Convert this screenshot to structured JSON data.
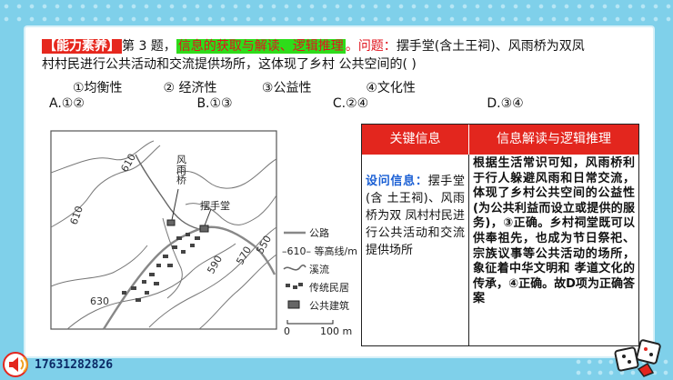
{
  "question": {
    "tag": "【能力素养】",
    "number": "第 3 题，",
    "focus": "信息的获取与解读、逻辑推理",
    "after_focus": "。",
    "ask_label": "问题：",
    "stem_line1_rest": "摆手堂(含土王祠)、风雨桥为双凤",
    "stem_line2": "村村民进行公共活动和交流提供场所，这体现了乡村 公共空间的(     )"
  },
  "statements": [
    "①均衡性",
    "② 经济性",
    "③公益性",
    "④文化性"
  ],
  "options": [
    "A.①②",
    "B.①③",
    "C.②④",
    "D.③④"
  ],
  "map": {
    "labels": {
      "bridge": "风雨桥",
      "hall": "摆手堂",
      "c610a": "610",
      "c610b": "610",
      "c590": "590",
      "c570": "570",
      "c550": "550",
      "c630": "630"
    },
    "legend": [
      {
        "name": "road",
        "text": "公路"
      },
      {
        "name": "contour",
        "text": "–610– 等高线/m"
      },
      {
        "name": "stream",
        "text": "溪流"
      },
      {
        "name": "dwelling",
        "text": "传统民居"
      },
      {
        "name": "public",
        "text": "公共建筑"
      }
    ],
    "scale": {
      "zero": "0",
      "length": "100 m"
    }
  },
  "table": {
    "header_left": "关键信息",
    "header_right": "信息解读与逻辑推理",
    "key_label": "设问信息：",
    "key_text": "摆手堂(含 土王祠)、风雨桥为双 凤村村民进行公共活动和交流提供场所",
    "reasoning": "根据生活常识可知，风雨桥利于行人躲避风雨和日常交流，体现了乡村公共空间的公益性(为公共利益而设立或提供的服务)，③正确。乡村祠堂既可以 供奉祖先，也成为节日祭祀、宗族议事等公共活动的场所，象征着中华文明和 孝道文化的传承，④正确。故D项为正确答案"
  },
  "footer": {
    "phone": "17631282826"
  },
  "colors": {
    "accent_red": "#e3261e",
    "highlight_green": "#2edc1a",
    "background": "#7fd0ea",
    "key_blue": "#1a5fd4"
  }
}
